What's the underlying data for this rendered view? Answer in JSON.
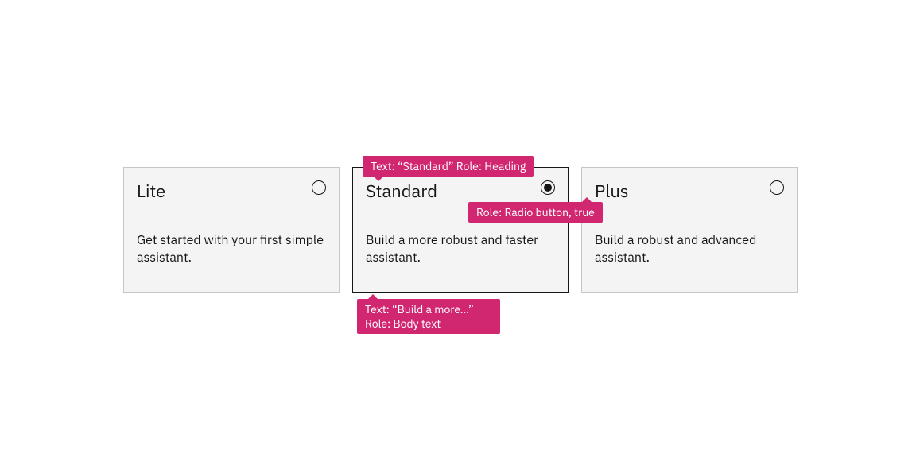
{
  "tiles": [
    {
      "title": "Lite",
      "body": "Get started with your first simple assistant.",
      "selected": false
    },
    {
      "title": "Standard",
      "body": "Build a more robust and faster assistant.",
      "selected": true
    },
    {
      "title": "Plus",
      "body": "Build a robust and advanced assistant.",
      "selected": false
    }
  ],
  "callouts": {
    "heading": "Text: “Standard” Role: Heading",
    "radio": "Role: Radio button, true",
    "body_l1": "Text: “Build a more…”",
    "body_l2": "Role: Body text"
  },
  "colors": {
    "accent": "#d12771",
    "tile_bg": "#f4f4f4",
    "tile_border": "#c6c6c6",
    "tile_border_selected": "#161616",
    "text": "#161616"
  }
}
